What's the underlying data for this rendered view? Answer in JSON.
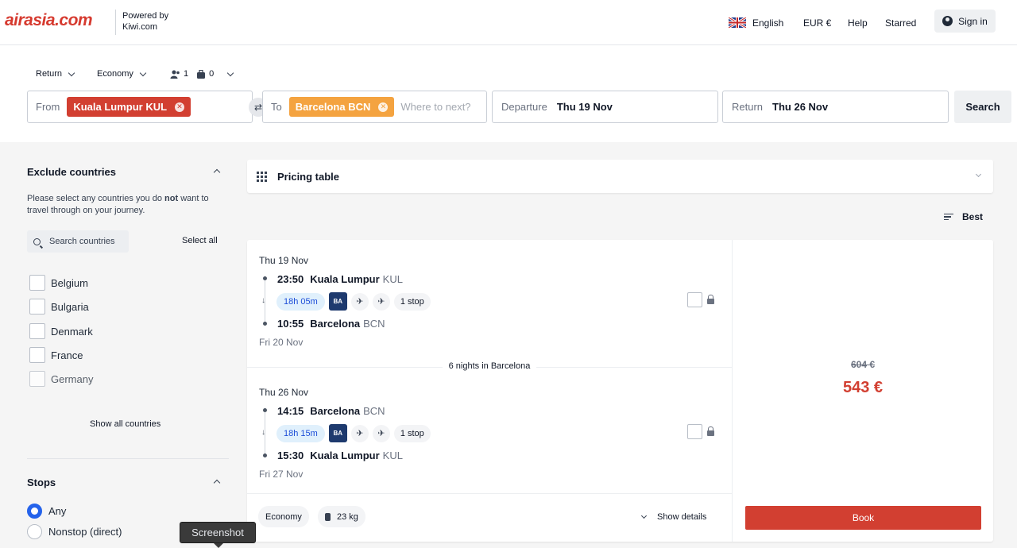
{
  "header": {
    "logo": "airasia.com",
    "powered_line1": "Powered by",
    "powered_line2": "Kiwi.com",
    "language": "English",
    "currency": "EUR €",
    "help": "Help",
    "starred": "Starred",
    "sign_in": "Sign in"
  },
  "search": {
    "trip_type": "Return",
    "cabin": "Economy",
    "passengers": "1",
    "bags": "0",
    "from_label": "From",
    "from_value": "Kuala Lumpur KUL",
    "to_label": "To",
    "to_value": "Barcelona BCN",
    "to_placeholder": "Where to next?",
    "departure_label": "Departure",
    "departure_value": "Thu 19 Nov",
    "return_label": "Return",
    "return_value": "Thu 26 Nov",
    "search_button": "Search",
    "colors": {
      "from_chip": "#d23f31",
      "to_chip": "#f4a340"
    }
  },
  "sidebar": {
    "exclude_title": "Exclude countries",
    "exclude_desc_before": "Please select any countries you do ",
    "exclude_desc_bold": "not",
    "exclude_desc_after": " want to travel through on your journey.",
    "search_countries": "Search countries",
    "select_all": "Select all",
    "countries": [
      "Belgium",
      "Bulgaria",
      "Denmark",
      "France",
      "Germany"
    ],
    "show_all": "Show all countries",
    "stops_title": "Stops",
    "stops_options": [
      "Any",
      "Nonstop (direct)"
    ],
    "stops_selected": "Any"
  },
  "results": {
    "pricing_table": "Pricing table",
    "sort": "Best",
    "card": {
      "outbound": {
        "date": "Thu 19 Nov",
        "dep_time": "23:50",
        "dep_city": "Kuala Lumpur",
        "dep_code": "KUL",
        "duration": "18h 05m",
        "airline": "BA",
        "stops": "1 stop",
        "arr_time": "10:55",
        "arr_city": "Barcelona",
        "arr_code": "BCN",
        "arr_date": "Fri 20 Nov"
      },
      "nights": "6 nights in Barcelona",
      "inbound": {
        "date": "Thu 26 Nov",
        "dep_time": "14:15",
        "dep_city": "Barcelona",
        "dep_code": "BCN",
        "duration": "18h 15m",
        "airline": "BA",
        "stops": "1 stop",
        "arr_time": "15:30",
        "arr_city": "Kuala Lumpur",
        "arr_code": "KUL",
        "arr_date": "Fri 27 Nov"
      },
      "cabin": "Economy",
      "baggage": "23 kg",
      "show_details": "Show details",
      "old_price": "604 €",
      "price": "543 €",
      "book": "Book"
    }
  },
  "tooltip": "Screenshot"
}
